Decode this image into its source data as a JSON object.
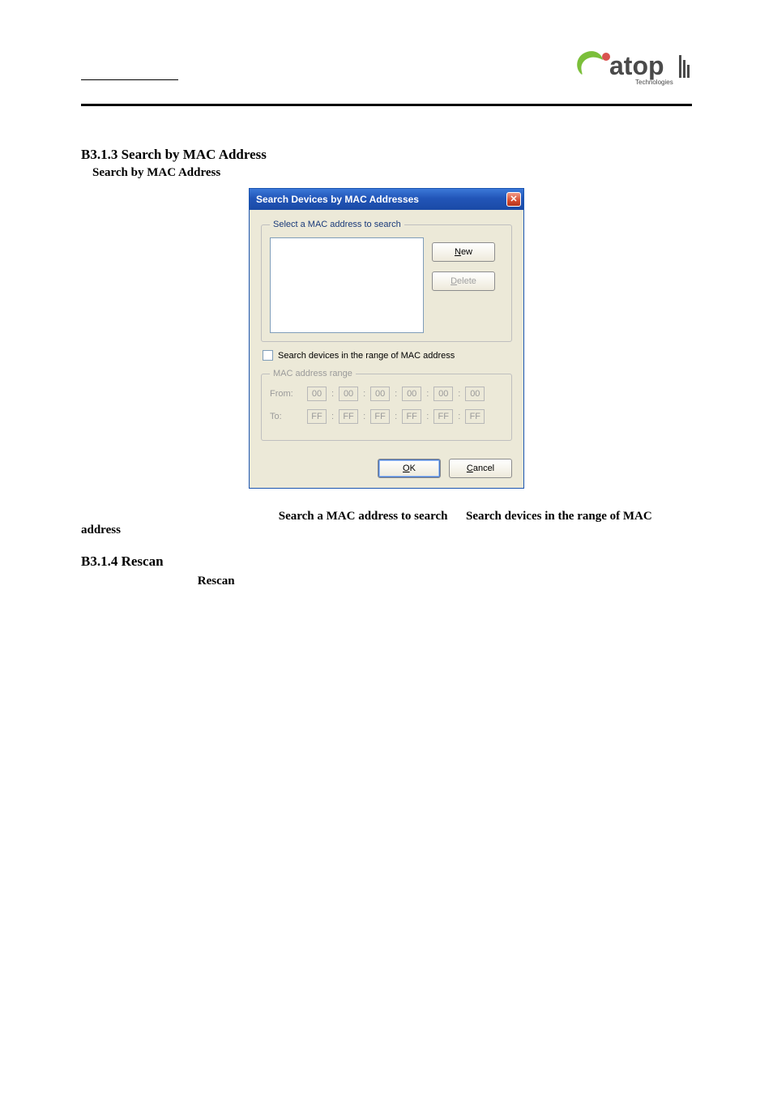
{
  "logo": {
    "primary_text": "atop",
    "sub_text": "Technologies",
    "green": "#7bbf3a",
    "red": "#d9534f",
    "dark": "#4a4a4a"
  },
  "section1": {
    "heading": "B3.1.3 Search by MAC Address",
    "subheading": "Search by MAC Address"
  },
  "dialog": {
    "title": "Search Devices by MAC Addresses",
    "close_glyph": "✕",
    "group1_legend": "Select a MAC address to search",
    "new_btn_u": "N",
    "new_btn_rest": "ew",
    "delete_btn_u": "D",
    "delete_btn_rest": "elete",
    "chk_label": "Search devices in the range of MAC address",
    "group2_legend": "MAC address range",
    "from_label": "From:",
    "to_label": "To:",
    "from_vals": [
      "00",
      "00",
      "00",
      "00",
      "00",
      "00"
    ],
    "to_vals": [
      "FF",
      "FF",
      "FF",
      "FF",
      "FF",
      "FF"
    ],
    "colon": ":",
    "ok_u": "O",
    "ok_rest": "K",
    "cancel_u": "C",
    "cancel_rest": "ancel"
  },
  "para": {
    "bold1": "Search a MAC address to search",
    "bold2": "Search devices in the range of MAC",
    "bold2_line2": "address"
  },
  "section2": {
    "heading": "B3.1.4 Rescan",
    "rescan_bold": "Rescan"
  }
}
